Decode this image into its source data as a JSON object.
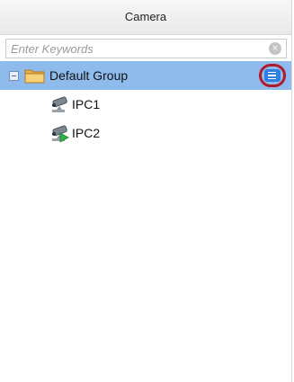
{
  "header": {
    "title": "Camera"
  },
  "search": {
    "placeholder": "Enter Keywords",
    "clear_icon": "clear-icon"
  },
  "tree": {
    "group": {
      "label": "Default Group",
      "expander_icon": "collapse-minus-icon",
      "icon": "folder-icon",
      "action_icon": "list-menu-icon"
    },
    "cameras": [
      {
        "label": "IPC1",
        "icon": "camera-icon",
        "status": "normal"
      },
      {
        "label": "IPC2",
        "icon": "camera-playing-icon",
        "status": "playing"
      }
    ]
  },
  "colors": {
    "selected_row": "#8fbbec",
    "highlight_ring": "#b11a2a",
    "action_button": "#2e7fe0",
    "play_badge": "#2db34a"
  }
}
